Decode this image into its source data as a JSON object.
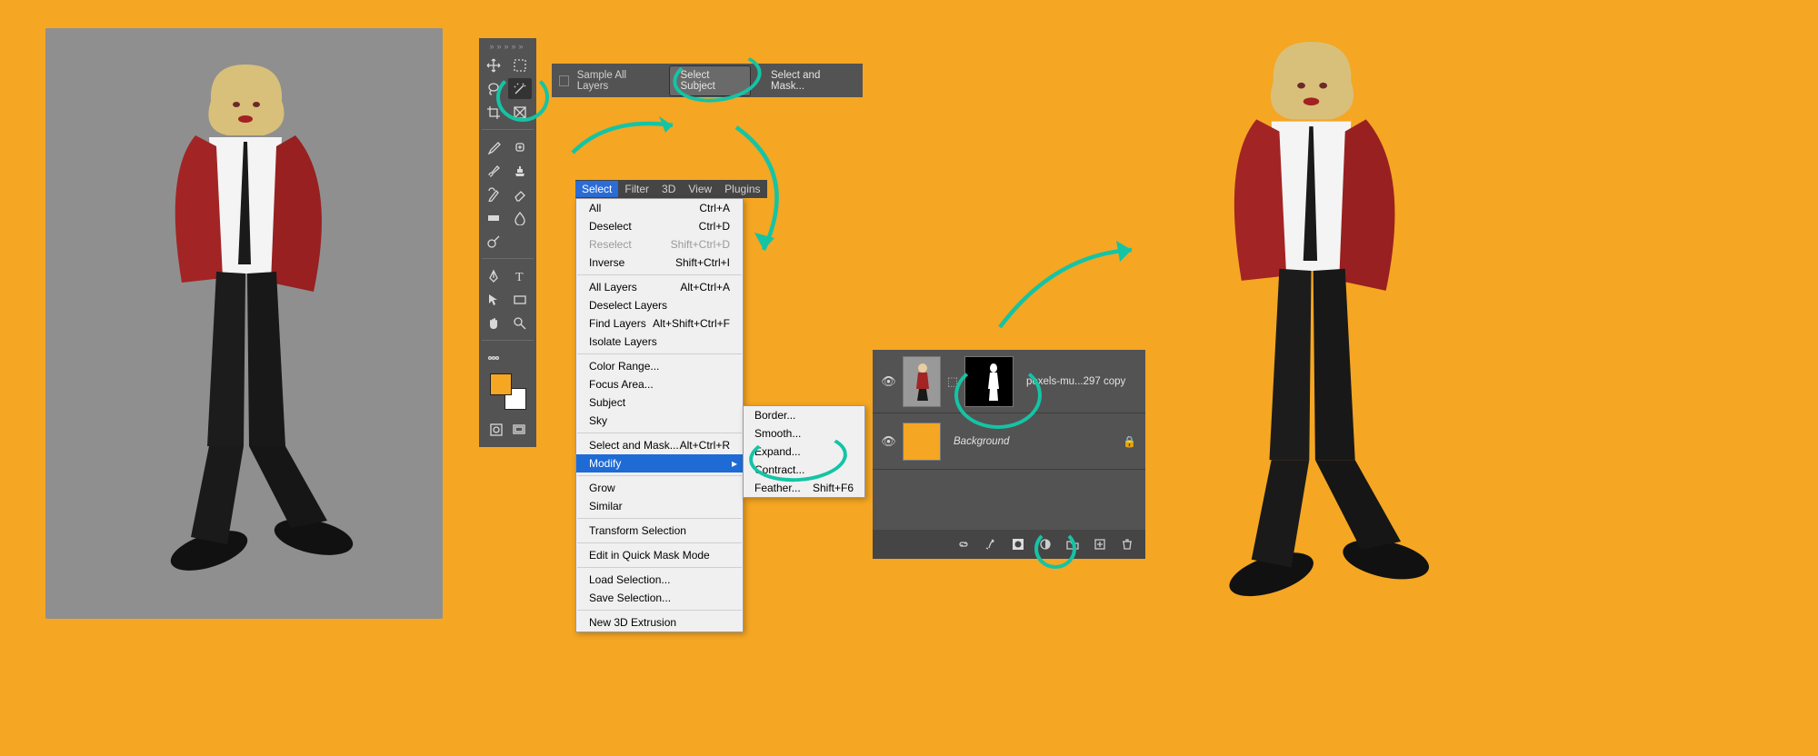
{
  "options_bar": {
    "sample_all_layers": "Sample All Layers",
    "select_subject": "Select Subject",
    "select_and_mask": "Select and Mask..."
  },
  "menubar": [
    "Select",
    "Filter",
    "3D",
    "View",
    "Plugins"
  ],
  "select_menu": {
    "g1": [
      {
        "label": "All",
        "sc": "Ctrl+A"
      },
      {
        "label": "Deselect",
        "sc": "Ctrl+D"
      },
      {
        "label": "Reselect",
        "sc": "Shift+Ctrl+D",
        "dis": true
      },
      {
        "label": "Inverse",
        "sc": "Shift+Ctrl+I"
      }
    ],
    "g2": [
      {
        "label": "All Layers",
        "sc": "Alt+Ctrl+A"
      },
      {
        "label": "Deselect Layers",
        "sc": ""
      },
      {
        "label": "Find Layers",
        "sc": "Alt+Shift+Ctrl+F"
      },
      {
        "label": "Isolate Layers",
        "sc": ""
      }
    ],
    "g3": [
      {
        "label": "Color Range...",
        "sc": ""
      },
      {
        "label": "Focus Area...",
        "sc": ""
      },
      {
        "label": "Subject",
        "sc": ""
      },
      {
        "label": "Sky",
        "sc": ""
      }
    ],
    "g4": [
      {
        "label": "Select and Mask...",
        "sc": "Alt+Ctrl+R"
      },
      {
        "label": "Modify",
        "sc": "",
        "sub": true,
        "hl": true
      }
    ],
    "g5": [
      {
        "label": "Grow",
        "sc": ""
      },
      {
        "label": "Similar",
        "sc": ""
      }
    ],
    "g6": [
      {
        "label": "Transform Selection",
        "sc": ""
      }
    ],
    "g7": [
      {
        "label": "Edit in Quick Mask Mode",
        "sc": ""
      }
    ],
    "g8": [
      {
        "label": "Load Selection...",
        "sc": ""
      },
      {
        "label": "Save Selection...",
        "sc": ""
      }
    ],
    "g9": [
      {
        "label": "New 3D Extrusion",
        "sc": ""
      }
    ]
  },
  "modify_submenu": [
    {
      "label": "Border...",
      "sc": ""
    },
    {
      "label": "Smooth...",
      "sc": ""
    },
    {
      "label": "Expand...",
      "sc": ""
    },
    {
      "label": "Contract...",
      "sc": ""
    },
    {
      "label": "Feather...",
      "sc": "Shift+F6"
    }
  ],
  "layers": {
    "layer1_name": "pexels-mu...297 copy",
    "bg_name": "Background"
  },
  "colors": {
    "accent": "#14c4a5",
    "bg": "#f5a623",
    "panel": "#535353"
  }
}
